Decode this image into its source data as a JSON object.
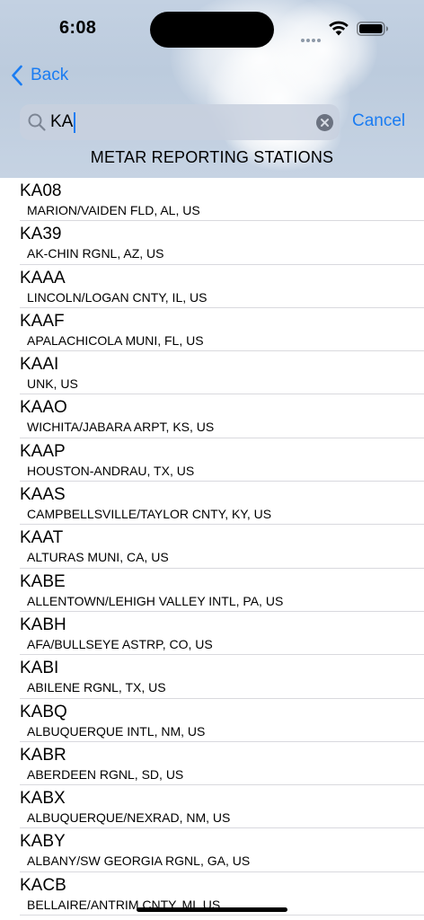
{
  "status_bar": {
    "time": "6:08"
  },
  "nav": {
    "back_label": "Back"
  },
  "search": {
    "value": "KA",
    "cancel_label": "Cancel"
  },
  "section": {
    "title": "METAR REPORTING STATIONS"
  },
  "colors": {
    "accent": "#1a7cf2",
    "separator": "#d9d9de"
  },
  "stations": [
    {
      "code": "KA08",
      "name": "MARION/VAIDEN FLD, AL, US"
    },
    {
      "code": "KA39",
      "name": "AK-CHIN RGNL, AZ, US"
    },
    {
      "code": "KAAA",
      "name": "LINCOLN/LOGAN CNTY, IL, US"
    },
    {
      "code": "KAAF",
      "name": "APALACHICOLA MUNI, FL, US"
    },
    {
      "code": "KAAI",
      "name": "UNK, US"
    },
    {
      "code": "KAAO",
      "name": "WICHITA/JABARA ARPT, KS, US"
    },
    {
      "code": "KAAP",
      "name": "HOUSTON-ANDRAU, TX, US"
    },
    {
      "code": "KAAS",
      "name": "CAMPBELLSVILLE/TAYLOR CNTY, KY, US"
    },
    {
      "code": "KAAT",
      "name": "ALTURAS MUNI, CA, US"
    },
    {
      "code": "KABE",
      "name": "ALLENTOWN/LEHIGH VALLEY INTL, PA, US"
    },
    {
      "code": "KABH",
      "name": "AFA/BULLSEYE ASTRP, CO, US"
    },
    {
      "code": "KABI",
      "name": "ABILENE RGNL, TX, US"
    },
    {
      "code": "KABQ",
      "name": "ALBUQUERQUE INTL, NM, US"
    },
    {
      "code": "KABR",
      "name": "ABERDEEN RGNL, SD, US"
    },
    {
      "code": "KABX",
      "name": "ALBUQUERQUE/NEXRAD, NM, US"
    },
    {
      "code": "KABY",
      "name": "ALBANY/SW GEORGIA RGNL, GA, US"
    },
    {
      "code": "KACB",
      "name": "BELLAIRE/ANTRIM CNTY, MI, US"
    }
  ]
}
